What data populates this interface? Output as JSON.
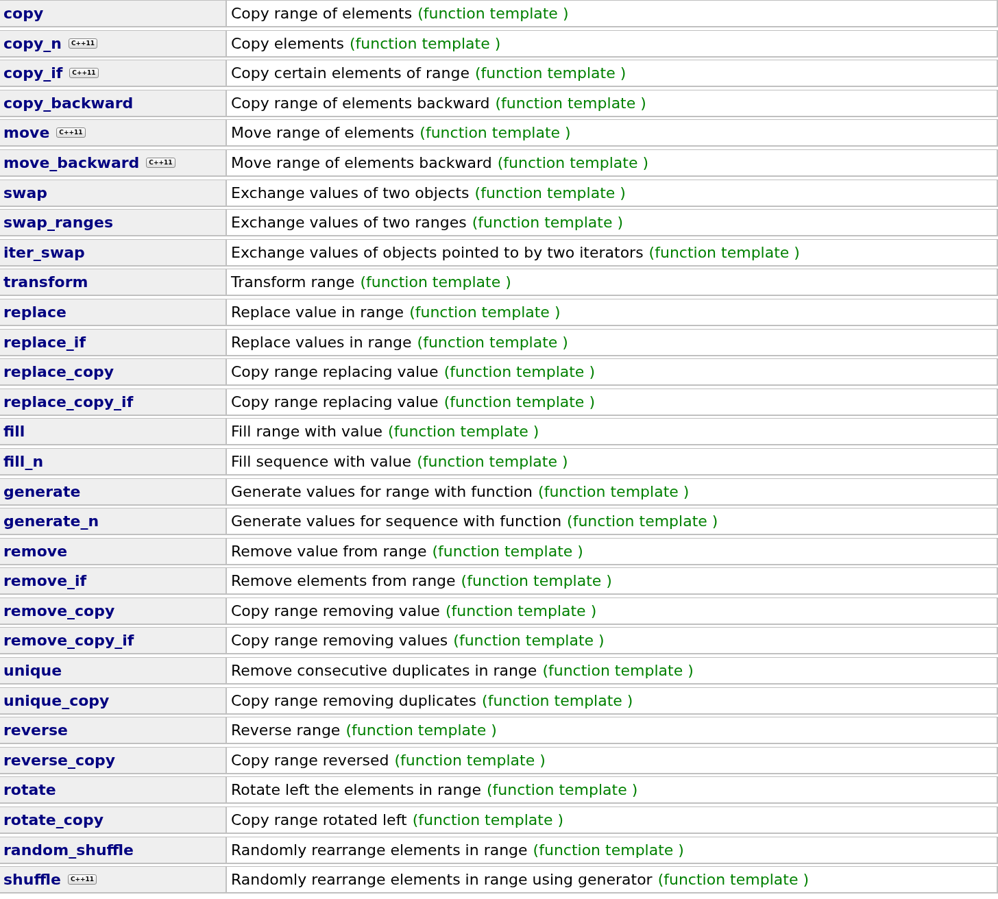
{
  "rows": [
    {
      "name": "copy",
      "description": "Copy range of elements",
      "type": "(function template )"
    },
    {
      "name": "copy_n",
      "badge": "C++11",
      "description": "Copy elements",
      "type": "(function template )"
    },
    {
      "name": "copy_if",
      "badge": "C++11",
      "description": "Copy certain elements of range",
      "type": "(function template )"
    },
    {
      "name": "copy_backward",
      "description": "Copy range of elements backward",
      "type": "(function template )"
    },
    {
      "name": "move",
      "badge": "C++11",
      "description": "Move range of elements",
      "type": "(function template )"
    },
    {
      "name": "move_backward",
      "badge": "C++11",
      "description": "Move range of elements backward",
      "type": "(function template )"
    },
    {
      "name": "swap",
      "description": "Exchange values of two objects",
      "type": "(function template )"
    },
    {
      "name": "swap_ranges",
      "description": "Exchange values of two ranges",
      "type": "(function template )"
    },
    {
      "name": "iter_swap",
      "description": "Exchange values of objects pointed to by two iterators",
      "type": "(function template )"
    },
    {
      "name": "transform",
      "description": "Transform range",
      "type": "(function template )"
    },
    {
      "name": "replace",
      "description": "Replace value in range",
      "type": "(function template )"
    },
    {
      "name": "replace_if",
      "description": "Replace values in range",
      "type": "(function template )"
    },
    {
      "name": "replace_copy",
      "description": "Copy range replacing value",
      "type": "(function template )"
    },
    {
      "name": "replace_copy_if",
      "description": "Copy range replacing value",
      "type": "(function template )"
    },
    {
      "name": "fill",
      "description": "Fill range with value",
      "type": "(function template )"
    },
    {
      "name": "fill_n",
      "description": "Fill sequence with value",
      "type": "(function template )"
    },
    {
      "name": "generate",
      "description": "Generate values for range with function",
      "type": "(function template )"
    },
    {
      "name": "generate_n",
      "description": "Generate values for sequence with function",
      "type": "(function template )"
    },
    {
      "name": "remove",
      "description": "Remove value from range",
      "type": "(function template )"
    },
    {
      "name": "remove_if",
      "description": "Remove elements from range",
      "type": "(function template )"
    },
    {
      "name": "remove_copy",
      "description": "Copy range removing value",
      "type": "(function template )"
    },
    {
      "name": "remove_copy_if",
      "description": "Copy range removing values",
      "type": "(function template )"
    },
    {
      "name": "unique",
      "description": "Remove consecutive duplicates in range",
      "type": "(function template )"
    },
    {
      "name": "unique_copy",
      "description": "Copy range removing duplicates",
      "type": "(function template )"
    },
    {
      "name": "reverse",
      "description": "Reverse range",
      "type": "(function template )"
    },
    {
      "name": "reverse_copy",
      "description": "Copy range reversed",
      "type": "(function template )"
    },
    {
      "name": "rotate",
      "description": "Rotate left the elements in range",
      "type": "(function template )"
    },
    {
      "name": "rotate_copy",
      "description": "Copy range rotated left",
      "type": "(function template )"
    },
    {
      "name": "random_shuffle",
      "description": "Randomly rearrange elements in range",
      "type": "(function template )"
    },
    {
      "name": "shuffle",
      "badge": "C++11",
      "description": "Randomly rearrange elements in range using generator",
      "type": "(function template )"
    }
  ]
}
